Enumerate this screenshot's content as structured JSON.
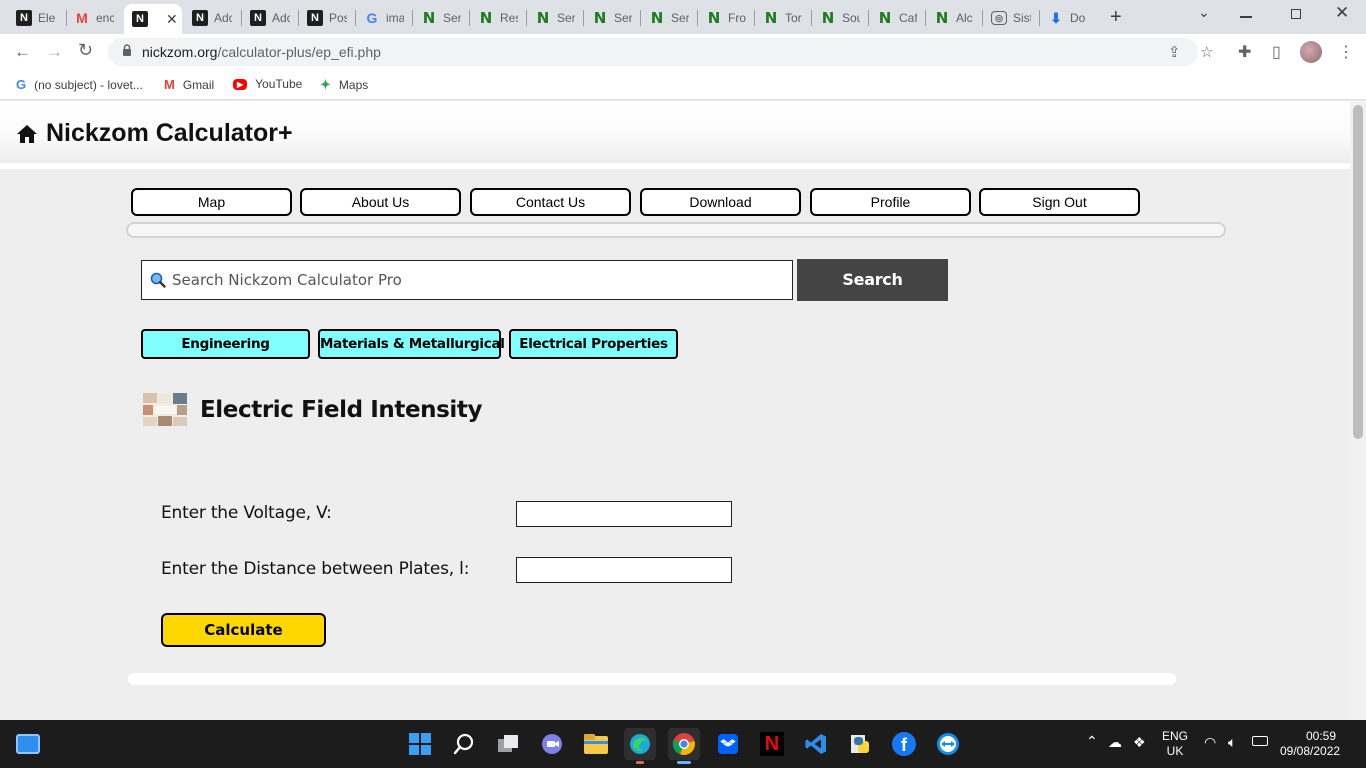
{
  "tabs": [
    {
      "title": "Elec",
      "icon": "n-icon"
    },
    {
      "title": "enc",
      "icon": "gmail-icon"
    },
    {
      "title": "",
      "icon": "n-icon",
      "active": true
    },
    {
      "title": "Adc",
      "icon": "n-icon"
    },
    {
      "title": "Adc",
      "icon": "n-icon"
    },
    {
      "title": "Pos",
      "icon": "n-icon"
    },
    {
      "title": "ima",
      "icon": "google-icon"
    },
    {
      "title": "Ser",
      "icon": "green-n-icon"
    },
    {
      "title": "Res",
      "icon": "green-n-icon"
    },
    {
      "title": "Ser",
      "icon": "green-n-icon"
    },
    {
      "title": "Ser",
      "icon": "green-n-icon"
    },
    {
      "title": "Ser",
      "icon": "green-n-icon"
    },
    {
      "title": "Fro",
      "icon": "green-n-icon"
    },
    {
      "title": "Tor",
      "icon": "green-n-icon"
    },
    {
      "title": "Sou",
      "icon": "green-n-icon"
    },
    {
      "title": "Caf",
      "icon": "green-n-icon"
    },
    {
      "title": "Alc",
      "icon": "green-n-icon"
    },
    {
      "title": "Sist",
      "icon": "lens-icon"
    },
    {
      "title": "Do",
      "icon": "download-icon"
    }
  ],
  "address": {
    "host": "nickzom.org",
    "path": "/calculator-plus/ep_efi.php"
  },
  "bookmarks": [
    {
      "label": "(no subject) - lovet...",
      "icon": "google-icon"
    },
    {
      "label": "Gmail",
      "icon": "gmail-icon"
    },
    {
      "label": "YouTube",
      "icon": "youtube-icon"
    },
    {
      "label": "Maps",
      "icon": "maps-icon"
    }
  ],
  "site": {
    "title": "Nickzom Calculator+"
  },
  "menu": [
    "Map",
    "About Us",
    "Contact Us",
    "Download",
    "Profile",
    "Sign Out"
  ],
  "search": {
    "placeholder": "Search Nickzom Calculator Pro",
    "button": "Search"
  },
  "breadcrumbs": [
    "Engineering",
    "Materials & Metallurgical",
    "Electrical Properties"
  ],
  "calculator": {
    "title": "Electric Field Intensity",
    "fields": [
      {
        "label": "Enter the Voltage, V:",
        "value": ""
      },
      {
        "label": "Enter the Distance between Plates, l:",
        "value": ""
      }
    ],
    "button": "Calculate"
  },
  "taskbar": {
    "language": "ENG",
    "region": "UK",
    "time": "00:59",
    "date": "09/08/2022"
  },
  "colors": {
    "crumb_bg": "#80ffff",
    "calc_button": "#ffd700",
    "search_button": "#444444"
  }
}
